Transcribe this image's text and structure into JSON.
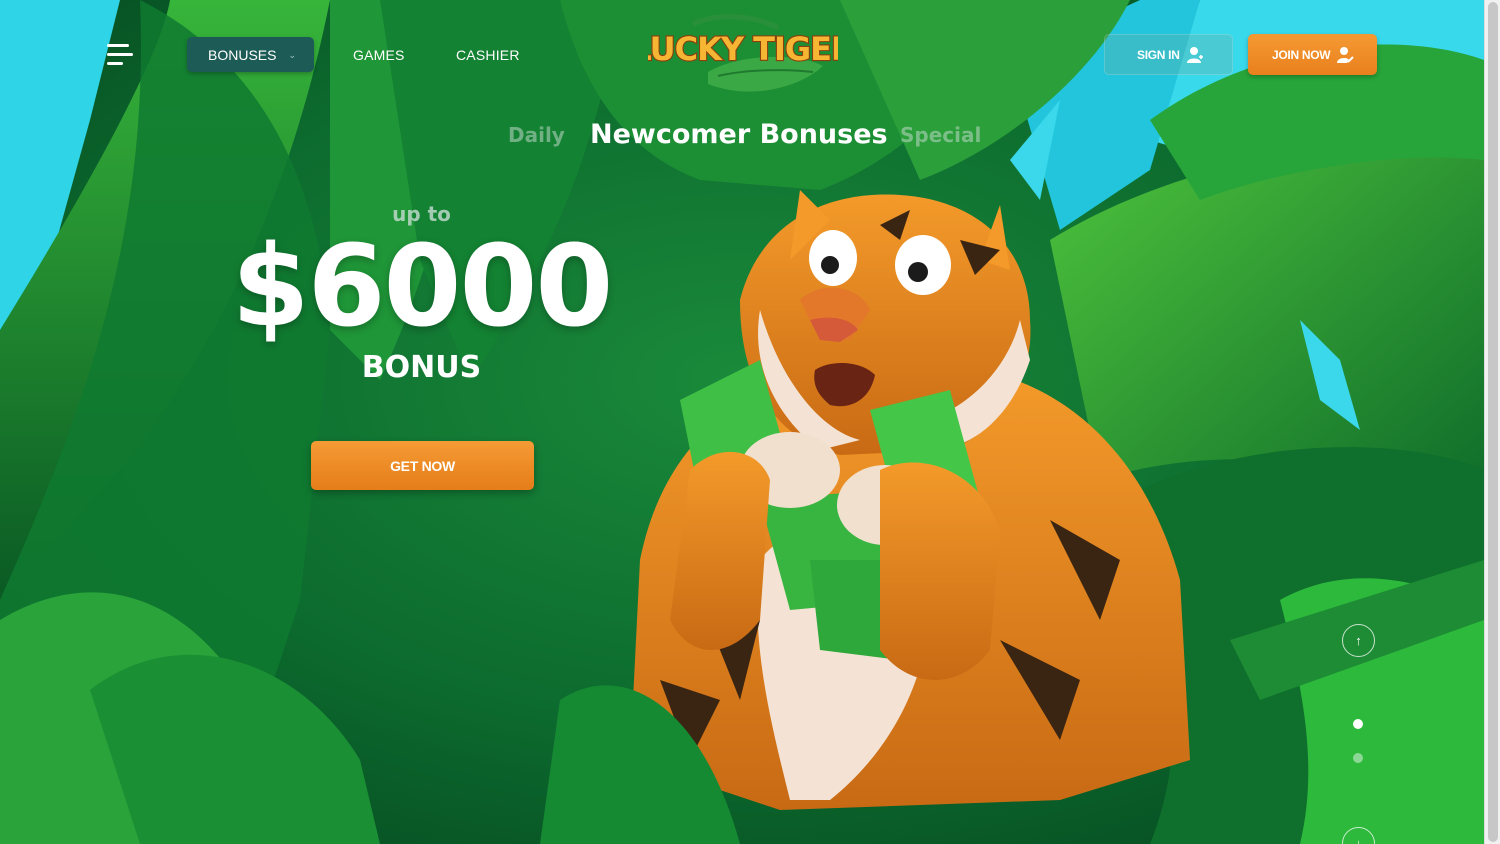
{
  "header": {
    "menu_icon": "hamburger-menu-icon",
    "nav": {
      "bonuses": "BONUSES",
      "games": "GAMES",
      "cashier": "CASHIER"
    },
    "logo_text": "LUCKY TIGER",
    "sign_in": "SIGN IN",
    "join_now": "JOIN NOW"
  },
  "tabs": {
    "daily": "Daily",
    "newcomer": "Newcomer Bonuses",
    "special": "Special"
  },
  "hero": {
    "up_to": "up to",
    "amount": "$6000",
    "bonus": "BONUS",
    "cta": "GET NOW"
  },
  "carousel": {
    "slides": 2,
    "active_slide": 1
  },
  "colors": {
    "accent_orange": "#ef8c28",
    "nav_active_bg": "#1d5c56",
    "jungle_green": "#0d6b2c"
  }
}
